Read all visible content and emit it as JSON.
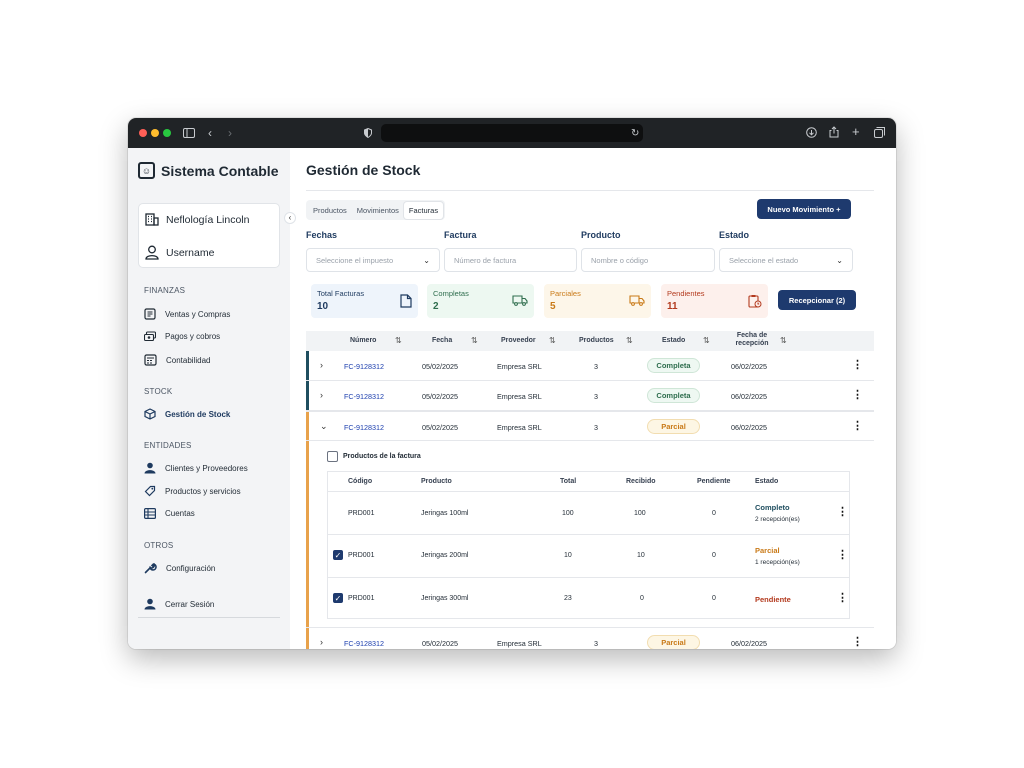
{
  "app": {
    "title": "Sistema Contable"
  },
  "sidebar": {
    "company": "Neflología Lincoln",
    "user": "Username",
    "sections": [
      {
        "title": "FINANZAS",
        "items": [
          "Ventas y Compras",
          "Pagos y cobros",
          "Contabilidad"
        ]
      },
      {
        "title": "STOCK",
        "items": [
          "Gestión de Stock"
        ]
      },
      {
        "title": "ENTIDADES",
        "items": [
          "Clientes y Proveedores",
          "Productos y servicios",
          "Cuentas"
        ]
      },
      {
        "title": "OTROS",
        "items": [
          "Configuración"
        ]
      }
    ],
    "logout": "Cerrar Sesión"
  },
  "page": {
    "title": "Gestión de Stock",
    "tabs": [
      "Productos",
      "Movimientos",
      "Facturas"
    ],
    "new_button": "Nuevo Movimiento +",
    "receive_button": "Recepcionar (2)"
  },
  "filters": [
    {
      "label": "Fechas",
      "placeholder": "Seleccione el impuesto"
    },
    {
      "label": "Factura",
      "placeholder": "Número de factura"
    },
    {
      "label": "Producto",
      "placeholder": "Nombre o código"
    },
    {
      "label": "Estado",
      "placeholder": "Seleccione el estado"
    }
  ],
  "stats": [
    {
      "label": "Total Facturas",
      "value": "10",
      "color": "#1e3a5f",
      "bg": "#eef4fb"
    },
    {
      "label": "Completas",
      "value": "2",
      "color": "#2f6e4e",
      "bg": "#edf8f1"
    },
    {
      "label": "Parciales",
      "value": "5",
      "color": "#c97a18",
      "bg": "#fdf6e9"
    },
    {
      "label": "Pendientes",
      "value": "11",
      "color": "#b33a1e",
      "bg": "#fdf0ec"
    }
  ],
  "table": {
    "headers": [
      "Número",
      "Fecha",
      "Proveedor",
      "Productos",
      "Estado",
      "Fecha de recepción"
    ],
    "rows": [
      {
        "numero": "FC-9128312",
        "fecha": "05/02/2025",
        "proveedor": "Empresa SRL",
        "productos": "3",
        "estado": "Completa",
        "recepcion": "06/02/2025",
        "chevron": "›"
      },
      {
        "numero": "FC-9128312",
        "fecha": "05/02/2025",
        "proveedor": "Empresa SRL",
        "productos": "3",
        "estado": "Completa",
        "recepcion": "06/02/2025",
        "chevron": "›"
      },
      {
        "numero": "FC-9128312",
        "fecha": "05/02/2025",
        "proveedor": "Empresa SRL",
        "productos": "3",
        "estado": "Parcial",
        "recepcion": "06/02/2025",
        "chevron": "⌄"
      },
      {
        "numero": "FC-9128312",
        "fecha": "05/02/2025",
        "proveedor": "Empresa SRL",
        "productos": "3",
        "estado": "Parcial",
        "recepcion": "06/02/2025",
        "chevron": "›"
      }
    ]
  },
  "invoice_products": {
    "title": "Productos de la factura",
    "headers": [
      "Código",
      "Producto",
      "Total",
      "Recibido",
      "Pendiente",
      "Estado"
    ],
    "rows": [
      {
        "codigo": "PRD001",
        "producto": "Jeringas 100ml",
        "total": "100",
        "recibido": "100",
        "pendiente": "0",
        "estado": "Completo",
        "detalle": "2 recepción(es)",
        "checked": false
      },
      {
        "codigo": "PRD001",
        "producto": "Jeringas 200ml",
        "total": "10",
        "recibido": "10",
        "pendiente": "0",
        "estado": "Parcial",
        "detalle": "1 recepción(es)",
        "checked": true
      },
      {
        "codigo": "PRD001",
        "producto": "Jeringas 300ml",
        "total": "23",
        "recibido": "0",
        "pendiente": "0",
        "estado": "Pendiente",
        "detalle": "",
        "checked": true
      }
    ]
  },
  "colors": {
    "accent": "#1e3a6e",
    "complete": "#2f6e4e",
    "partial": "#c97a18",
    "pending": "#b33a1e"
  }
}
